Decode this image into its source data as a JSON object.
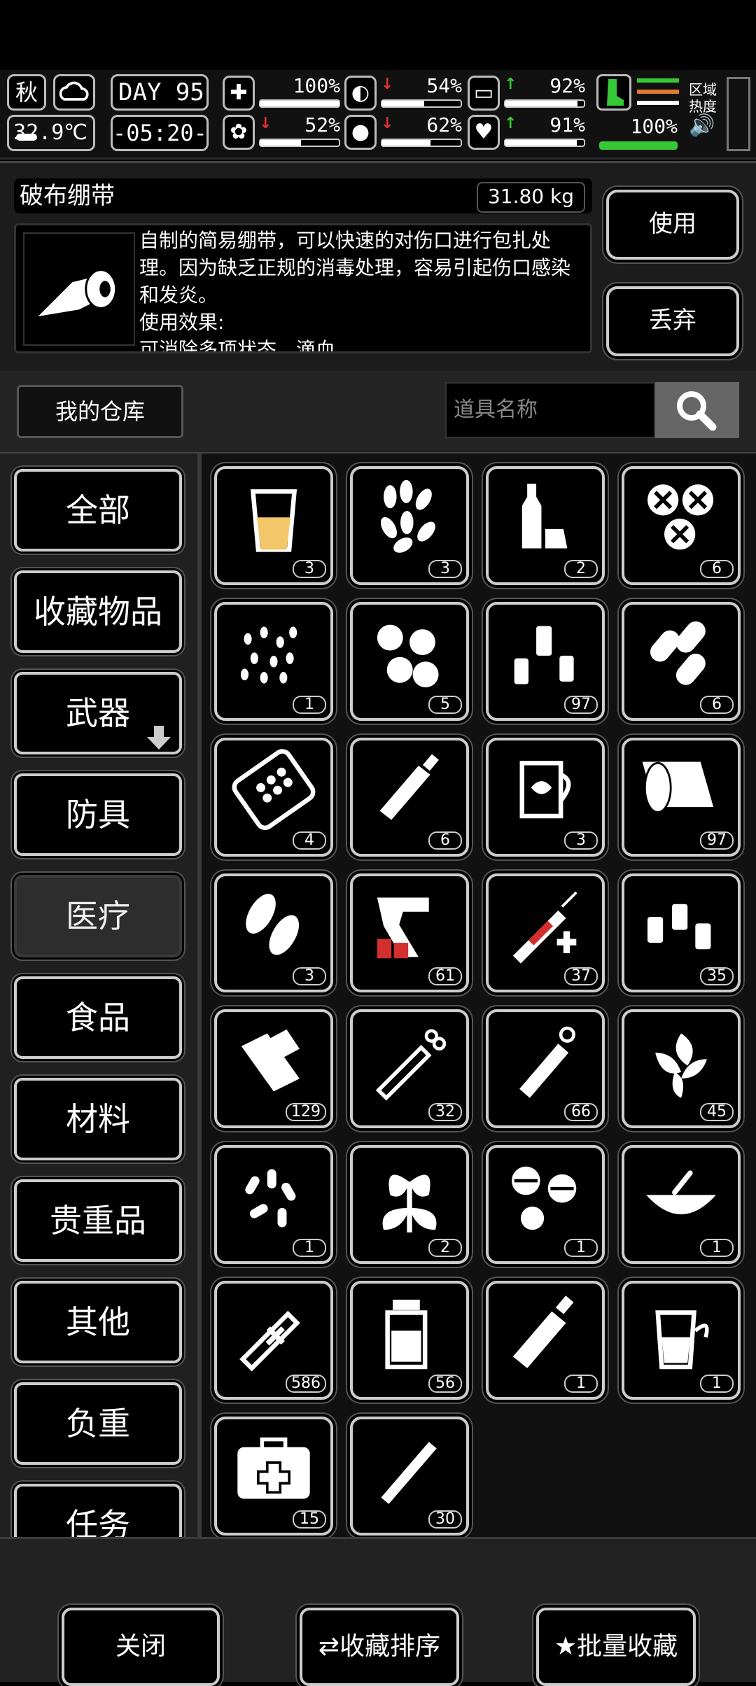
{
  "hud": {
    "season": "秋",
    "temperature": "32.9℃",
    "day_label": "DAY",
    "day_number": "95",
    "time": "-05:20-",
    "stats": [
      {
        "name": "health",
        "icon": "medkit-icon",
        "value": "100%",
        "arrow": "",
        "level": 1.0
      },
      {
        "name": "hunger",
        "icon": "stomach-icon",
        "value": "54%",
        "arrow": "↓",
        "arrow_color": "#e23030",
        "level": 0.54
      },
      {
        "name": "energy",
        "icon": "capsule-icon",
        "value": "92%",
        "arrow": "↑",
        "arrow_color": "#37c837",
        "level": 0.92
      },
      {
        "name": "mood",
        "icon": "brain-icon",
        "value": "52%",
        "arrow": "↓",
        "arrow_color": "#e23030",
        "level": 0.52
      },
      {
        "name": "thirst",
        "icon": "water-drop-icon",
        "value": "62%",
        "arrow": "↓",
        "arrow_color": "#e23030",
        "level": 0.62
      },
      {
        "name": "heart",
        "icon": "heart-icon",
        "value": "91%",
        "arrow": "↑",
        "arrow_color": "#37c837",
        "level": 0.91
      }
    ],
    "leg_value": "100%",
    "leg_color": "#37c837",
    "zone_line1": "区域",
    "zone_line2": "热度"
  },
  "detail": {
    "title": "破布绷带",
    "weight": "31.80 kg",
    "description": "自制的简易绷带，可以快速的对伤口进行包扎处理。因为缺乏正规的消毒处理，容易引起伤口感染和发炎。\n使用效果:\n可消除多项状态，滴血",
    "use_label": "使用",
    "discard_label": "丢弃"
  },
  "search": {
    "warehouse_label": "我的仓库",
    "placeholder": "道具名称"
  },
  "categories": [
    {
      "label": "全部"
    },
    {
      "label": "收藏物品"
    },
    {
      "label": "武器"
    },
    {
      "label": "防具"
    },
    {
      "label": "医疗"
    },
    {
      "label": "食品"
    },
    {
      "label": "材料"
    },
    {
      "label": "贵重品"
    },
    {
      "label": "其他"
    },
    {
      "label": "负重"
    },
    {
      "label": "任务"
    }
  ],
  "active_category": "医疗",
  "items": [
    {
      "icon": "glass-of-liquid-icon",
      "count": "3"
    },
    {
      "icon": "herb-leaves-icon",
      "count": "3"
    },
    {
      "icon": "liquor-bottle-icon",
      "count": "2"
    },
    {
      "icon": "cross-tablets-icon",
      "count": "6"
    },
    {
      "icon": "seeds-icon",
      "count": "1"
    },
    {
      "icon": "round-pills-icon",
      "count": "5"
    },
    {
      "icon": "small-bottles-icon",
      "count": "97"
    },
    {
      "icon": "capsules-icon",
      "count": "6"
    },
    {
      "icon": "blister-pack-icon",
      "count": "4"
    },
    {
      "icon": "ointment-tube-icon",
      "count": "6"
    },
    {
      "icon": "herbal-tea-jug-icon",
      "count": "3"
    },
    {
      "icon": "bandage-roll-icon",
      "count": "97"
    },
    {
      "icon": "oval-pills-icon",
      "count": "3"
    },
    {
      "icon": "flare-gun-icon",
      "count": "61"
    },
    {
      "icon": "red-syringe-icon",
      "count": "37"
    },
    {
      "icon": "vials-icon",
      "count": "35"
    },
    {
      "icon": "splint-icon",
      "count": "129"
    },
    {
      "icon": "syringe-icon",
      "count": "32"
    },
    {
      "icon": "injector-pen-icon",
      "count": "66"
    },
    {
      "icon": "mint-leaves-icon",
      "count": "45"
    },
    {
      "icon": "pill-pile-icon",
      "count": "1"
    },
    {
      "icon": "plant-icon",
      "count": "2"
    },
    {
      "icon": "split-tablets-icon",
      "count": "1"
    },
    {
      "icon": "soup-bowl-icon",
      "count": "1"
    },
    {
      "icon": "auto-injector-icon",
      "count": "586"
    },
    {
      "icon": "medicine-jar-icon",
      "count": "56"
    },
    {
      "icon": "cream-tube-icon",
      "count": "1"
    },
    {
      "icon": "drink-cup-icon",
      "count": "1"
    },
    {
      "icon": "first-aid-kit-icon",
      "count": "15"
    },
    {
      "icon": "cigarette-icon",
      "count": "30"
    }
  ],
  "bottom": {
    "close_label": "关闭",
    "sort_label": "收藏排序",
    "batch_label": "批量收藏"
  }
}
